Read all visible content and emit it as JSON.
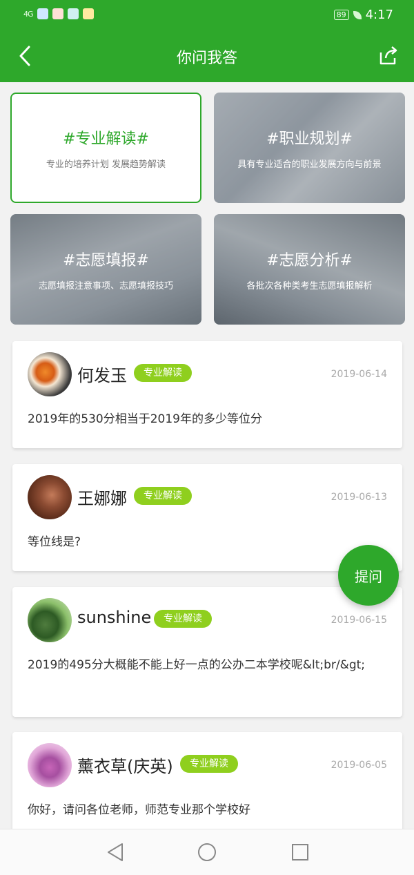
{
  "status_bar": {
    "signal": "4G",
    "battery": "89",
    "time": "4:17"
  },
  "header": {
    "title": "你问我答"
  },
  "categories": [
    {
      "title": "#专业解读#",
      "subtitle": "专业的培养计划 发展趋势解读"
    },
    {
      "title": "#职业规划#",
      "subtitle": "具有专业适合的职业发展方向与前景"
    },
    {
      "title": "#志愿填报#",
      "subtitle": "志愿填报注意事项、志愿填报技巧"
    },
    {
      "title": "#志愿分析#",
      "subtitle": "各批次各种类考生志愿填报解析"
    }
  ],
  "questions": [
    {
      "name": "何发玉",
      "tag": "专业解读",
      "date": "2019-06-14",
      "content": "2019年的530分相当于2019年的多少等位分"
    },
    {
      "name": "王娜娜",
      "tag": "专业解读",
      "date": "2019-06-13",
      "content": "等位线是?"
    },
    {
      "name": "sunshine",
      "tag": "专业解读",
      "date": "2019-06-15",
      "content": "2019的495分大概能不能上好一点的公办二本学校呢&lt;br/&gt;"
    },
    {
      "name": "薰衣草(庆英)",
      "tag": "专业解读",
      "date": "2019-06-05",
      "content": "你好，请问各位老师，师范专业那个学校好"
    }
  ],
  "ask_button": "提问",
  "colors": {
    "primary": "#2ea82b",
    "tag": "#8fcf1e"
  },
  "icons": {
    "back": "chevron-left-icon",
    "share": "share-icon",
    "nav_back": "triangle-back-icon",
    "nav_home": "circle-home-icon",
    "nav_recent": "square-recent-icon"
  }
}
